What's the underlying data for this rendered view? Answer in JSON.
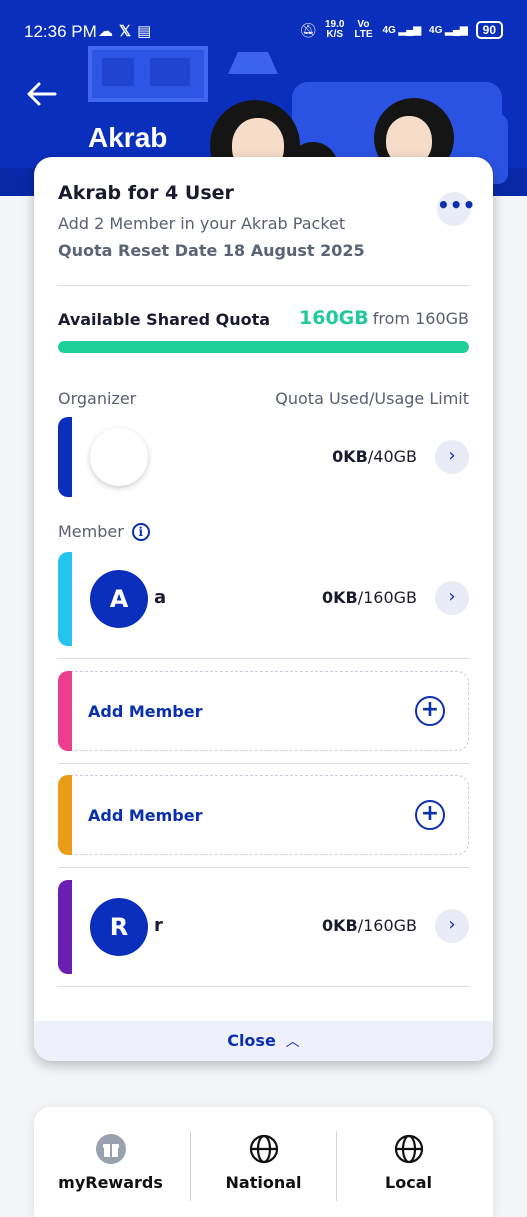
{
  "status_bar": {
    "time": "12:36 PM",
    "left_icons": [
      "cloud-icon",
      "x-icon",
      "message-icon"
    ],
    "speed_value": "19.0",
    "speed_unit": "K/S",
    "volte": "Vo LTE",
    "network_1": "4G",
    "network_2": "4G",
    "battery": "90"
  },
  "header": {
    "title": "Akrab",
    "back_icon": "arrow-left-icon"
  },
  "card": {
    "title": "Akrab for 4 User",
    "subtitle": "Add 2 Member in your Akrab Packet",
    "reset_text": "Quota Reset Date 18 August 2025",
    "more_icon": "more-horizontal-icon",
    "quota": {
      "label": "Available Shared Quota",
      "available": "160GB",
      "from_text": "from 160GB",
      "available_fraction": 1.0
    },
    "columns": {
      "left": "Organizer",
      "right": "Quota Used/Usage Limit"
    },
    "organizer": {
      "used": "0KB",
      "limit": "/40GB",
      "stripe_color": "#0a2fbd"
    },
    "member_heading": "Member",
    "members": [
      {
        "initial": "A",
        "name": "a",
        "used": "0KB",
        "limit": "/160GB",
        "stripe_color": "#25c4ef"
      },
      {
        "initial": "R",
        "name": "r",
        "used": "0KB",
        "limit": "/160GB",
        "stripe_color": "#6a1fb0"
      }
    ],
    "add_slots": [
      {
        "label": "Add Member",
        "stripe_color": "#ec3d8e"
      },
      {
        "label": "Add Member",
        "stripe_color": "#e99d17"
      }
    ],
    "close_label": "Close"
  },
  "bottom_nav": [
    {
      "label": "myRewards",
      "icon": "gift-icon"
    },
    {
      "label": "National",
      "icon": "globe-icon"
    },
    {
      "label": "Local",
      "icon": "globe-icon"
    }
  ],
  "colors": {
    "brand_blue": "#0a2fbd",
    "quota_green": "#1fcf98"
  }
}
